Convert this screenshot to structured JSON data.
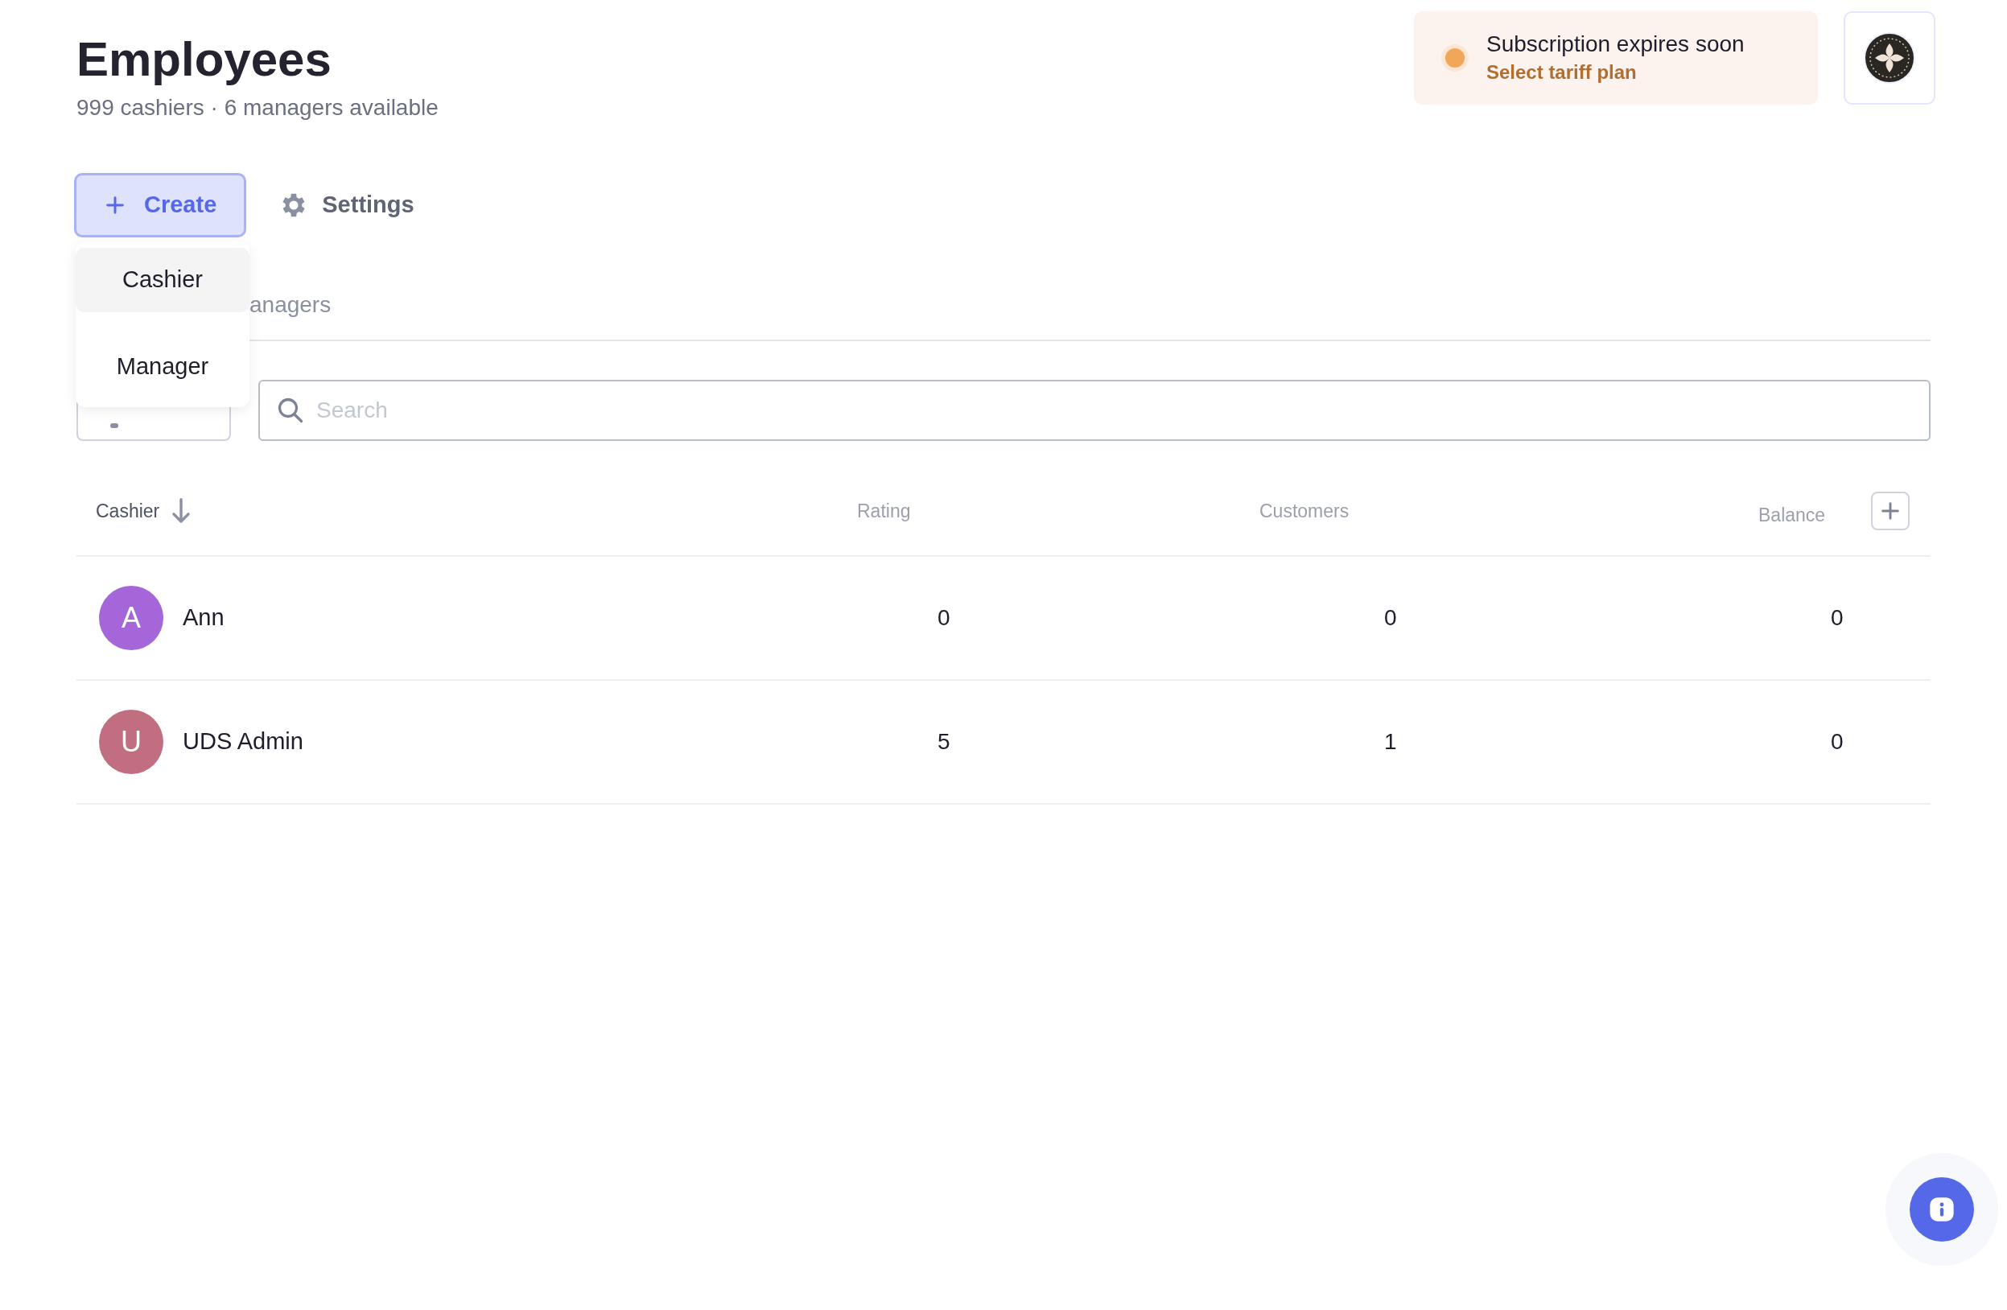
{
  "header": {
    "title": "Employees",
    "subtitle": "999 cashiers · 6 managers available"
  },
  "subscription": {
    "message": "Subscription expires soon",
    "link": "Select tariff plan"
  },
  "toolbar": {
    "create": {
      "label": "Create",
      "expanded": true
    },
    "settings": {
      "label": "Settings"
    }
  },
  "create_menu": [
    {
      "label": "Cashier",
      "selected": true
    },
    {
      "label": "Manager",
      "selected": false
    }
  ],
  "tabs": [
    {
      "label": "anagers"
    }
  ],
  "search": {
    "placeholder": "Search"
  },
  "table": {
    "columns": [
      {
        "label": "Cashier",
        "sorted": true
      },
      {
        "label": "Rating",
        "sorted": false
      },
      {
        "label": "Customers",
        "sorted": false
      },
      {
        "label": "Balance",
        "sorted": false
      }
    ],
    "rows": [
      {
        "initial": "A",
        "color": "#a566d9",
        "name": "Ann",
        "rating": "0",
        "customers": "0",
        "balance": "0"
      },
      {
        "initial": "U",
        "color": "#c06e80",
        "name": "UDS Admin",
        "rating": "5",
        "customers": "1",
        "balance": "0"
      }
    ]
  }
}
